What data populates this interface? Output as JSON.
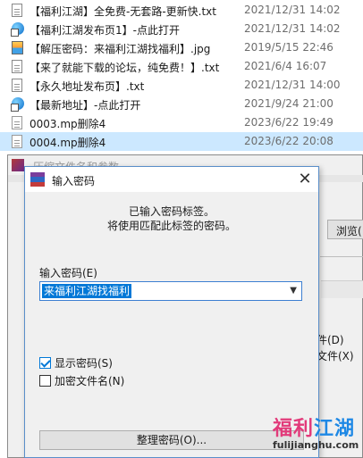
{
  "files": [
    {
      "name": "【福利江湖】全免费-无套路-更新快.txt",
      "date": "2021/12/31 14:02",
      "icon": "text-file-icon"
    },
    {
      "name": "【福利江湖发布页1】-点此打开",
      "date": "2021/12/31 14:02",
      "icon": "internet-shortcut-icon"
    },
    {
      "name": "【解压密码：来福利江湖找福利】.jpg",
      "date": "2019/5/15 22:46",
      "icon": "image-file-icon"
    },
    {
      "name": "【来了就能下载的论坛，纯免费！】.txt",
      "date": "2021/6/4 16:07",
      "icon": "text-file-icon"
    },
    {
      "name": "【永久地址发布页】.txt",
      "date": "2021/12/31 14:00",
      "icon": "text-file-icon"
    },
    {
      "name": "【最新地址】-点此打开",
      "date": "2021/9/24 21:00",
      "icon": "internet-shortcut-icon"
    },
    {
      "name": "0003.mp删除4",
      "date": "2023/6/22 19:49",
      "icon": "file-icon"
    },
    {
      "name": "0004.mp删除4",
      "date": "2023/6/22 20:08",
      "icon": "file-icon",
      "selected": true
    }
  ],
  "back_window": {
    "title": "压缩文件名和参数",
    "browse_label": "浏览(",
    "option_1": "件(D)",
    "option_2": "文件(X)"
  },
  "dialog": {
    "title": "输入密码",
    "close_glyph": "✕",
    "info_line_1": "已输入密码标签。",
    "info_line_2": "将使用匹配此标签的密码。",
    "password_label": "输入密码(E)",
    "password_value": "来福利江湖找福利",
    "show_password_label": "显示密码(S)",
    "show_password_checked": true,
    "encrypt_names_label": "加密文件名(N)",
    "encrypt_names_checked": false,
    "manage_button_label": "整理密码(O)..."
  },
  "watermark": {
    "text_a": "福利",
    "text_b": "江湖",
    "url": "fulijianghu.com"
  },
  "colors": {
    "selection": "#cce8ff",
    "accent": "#0078d7",
    "watermark_pink": "#e23a7a",
    "watermark_blue": "#1e88e5"
  }
}
